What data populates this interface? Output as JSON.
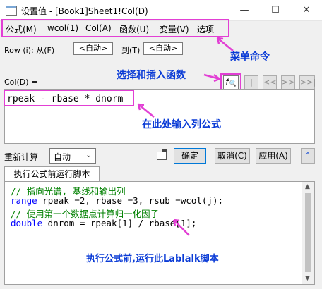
{
  "window": {
    "title": "设置值 - [Book1]Sheet1!Col(D)",
    "minimize_icon": "minimize-icon",
    "maximize_icon": "maximize-icon",
    "close_icon": "close-icon"
  },
  "menu": {
    "items": [
      "公式(M)",
      "wcol(1)",
      "Col(A)",
      "函数(U)",
      "变量(V)",
      "选项"
    ]
  },
  "row_range": {
    "label": "Row (i): 从(F)",
    "from_value": "<自动>",
    "to_label": "到(T)",
    "to_value": "<自动>"
  },
  "col_label": "Col(D) =",
  "nav_buttons": [
    "|<<",
    "<<",
    ">>",
    ">>|"
  ],
  "formula": "rpeak - rbase * dnorm",
  "recalc": {
    "label": "重新计算",
    "value": "自动"
  },
  "buttons": {
    "ok": "确定",
    "cancel": "取消(C)",
    "apply": "应用(A)"
  },
  "script_tab": "执行公式前运行脚本",
  "script_lines": [
    {
      "text": "// 指向光谱, 基线和输出列",
      "color": "#008000"
    },
    {
      "text": "range rpeak =2, rbase =3, rsub =wcol(j);",
      "color": "#000000"
    },
    {
      "text": "// 使用第一个数据点计算归一化因子",
      "color": "#008000"
    },
    {
      "text": "double dnrom = rpeak[1] / rbase[1];",
      "color": "#000000"
    }
  ],
  "callouts": {
    "menu": "菜单命令",
    "function": "选择和插入函数",
    "formula": "在此处输入列公式",
    "script": "执行公式前,运行此Lablalk脚本"
  },
  "colors": {
    "callout_text": "#0a3bd6",
    "highlight": "#e23fd4",
    "keyword": "#0000ff",
    "comment": "#008000"
  }
}
